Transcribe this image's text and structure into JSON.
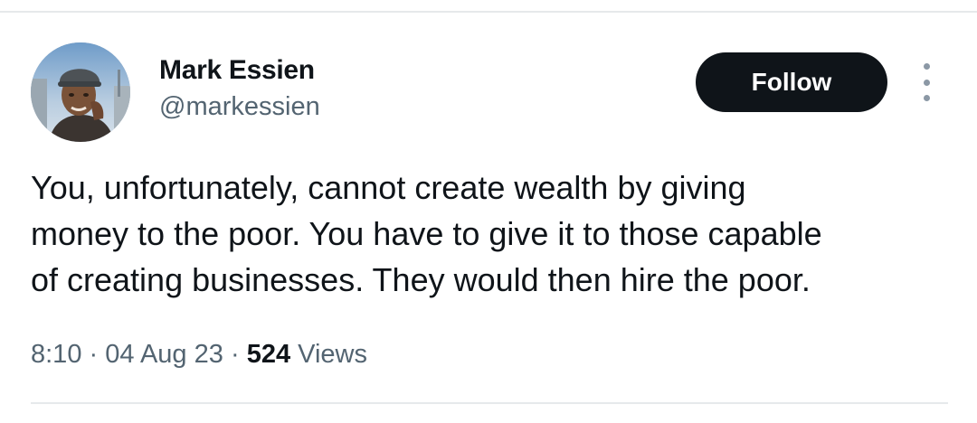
{
  "author": {
    "display_name": "Mark Essien",
    "handle": "@markessien"
  },
  "actions": {
    "follow_label": "Follow",
    "more_icon": "more-vertical-icon"
  },
  "tweet": {
    "lines": [
      "You, unfortunately, cannot create wealth by giving",
      "money to the poor. You have to give it to those capable",
      "of creating businesses. They would then hire the poor."
    ]
  },
  "meta": {
    "time": "8:10",
    "separator": "·",
    "date": "04 Aug 23",
    "views_count": "524",
    "views_label": "Views"
  },
  "colors": {
    "text_primary": "#0f1419",
    "text_secondary": "#536471",
    "follow_bg": "#0f1419",
    "follow_text": "#ffffff",
    "divider": "#e6e9eb"
  }
}
